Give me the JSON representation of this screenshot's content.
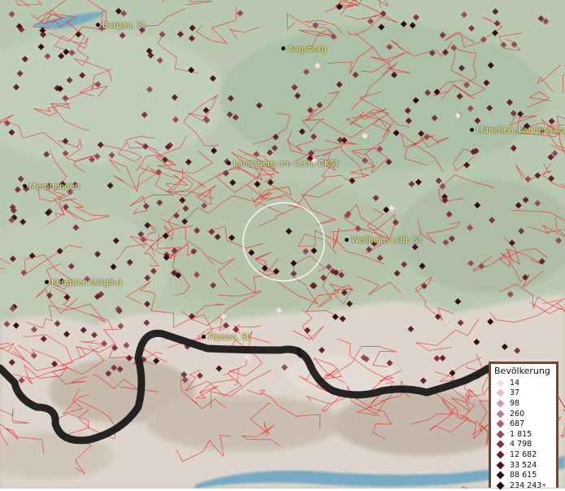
{
  "map": {
    "colors": {
      "land": "#b9c8b0",
      "alps": "#ddd5cc",
      "boundary": "#f02020",
      "lake": "#79aac4",
      "state_border": "#151515"
    },
    "places": [
      {
        "name": "Burgau, St"
      },
      {
        "name": "Augsburg"
      },
      {
        "name": "München, Landeshaup"
      },
      {
        "name": "Landsberg am Lech, GKSt"
      },
      {
        "name": "Memmingen"
      },
      {
        "name": "Weilheim i.OB, St"
      },
      {
        "name": "Kempten (Allgäu)"
      },
      {
        "name": "Füssen, St"
      }
    ]
  },
  "legend": {
    "title": "Bevölkerung",
    "items": [
      {
        "label": "14",
        "color": "#f5dce6"
      },
      {
        "label": "37",
        "color": "#e6bccb"
      },
      {
        "label": "98",
        "color": "#d29aad"
      },
      {
        "label": "260",
        "color": "#bb7c8e"
      },
      {
        "label": "687",
        "color": "#a9606f"
      },
      {
        "label": "1 815",
        "color": "#974a58"
      },
      {
        "label": "4 798",
        "color": "#7f3442"
      },
      {
        "label": "12 682",
        "color": "#672230"
      },
      {
        "label": "33 524",
        "color": "#4d1420"
      },
      {
        "label": "88 615",
        "color": "#340a13"
      },
      {
        "label": "234 243",
        "color": "#1a0408",
        "suffix": "+"
      }
    ]
  }
}
